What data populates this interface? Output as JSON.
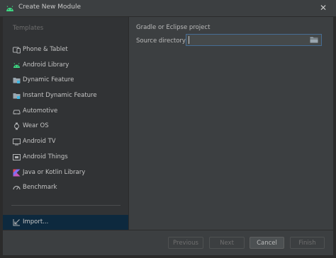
{
  "window": {
    "title": "Create New Module",
    "app_icon": "android-icon",
    "close_label": "✕"
  },
  "sidebar": {
    "header": "Templates",
    "items": [
      {
        "label": "Phone & Tablet",
        "icon": "phone-tablet-icon"
      },
      {
        "label": "Android Library",
        "icon": "android-icon"
      },
      {
        "label": "Dynamic Feature",
        "icon": "folder-module-icon"
      },
      {
        "label": "Instant Dynamic Feature",
        "icon": "folder-module-icon"
      },
      {
        "label": "Automotive",
        "icon": "car-icon"
      },
      {
        "label": "Wear OS",
        "icon": "watch-icon"
      },
      {
        "label": "Android TV",
        "icon": "tv-icon"
      },
      {
        "label": "Android Things",
        "icon": "things-icon"
      },
      {
        "label": "Java or Kotlin Library",
        "icon": "kotlin-icon"
      },
      {
        "label": "Benchmark",
        "icon": "gauge-icon"
      }
    ],
    "import_item": {
      "label": "Import...",
      "icon": "import-icon",
      "selected": true
    }
  },
  "content": {
    "section_title": "Gradle or Eclipse project",
    "source_label": "Source directory:",
    "source_value": "",
    "folder_icon": "folder-icon"
  },
  "footer": {
    "previous_label": "Previous",
    "next_label": "Next",
    "cancel_label": "Cancel",
    "finish_label": "Finish"
  },
  "colors": {
    "background": "#3c3f41",
    "sidebar": "#313335",
    "selection": "#0d293e",
    "focus_border": "#466d94",
    "android_green": "#3ddc84",
    "text": "#bbbbbb"
  }
}
